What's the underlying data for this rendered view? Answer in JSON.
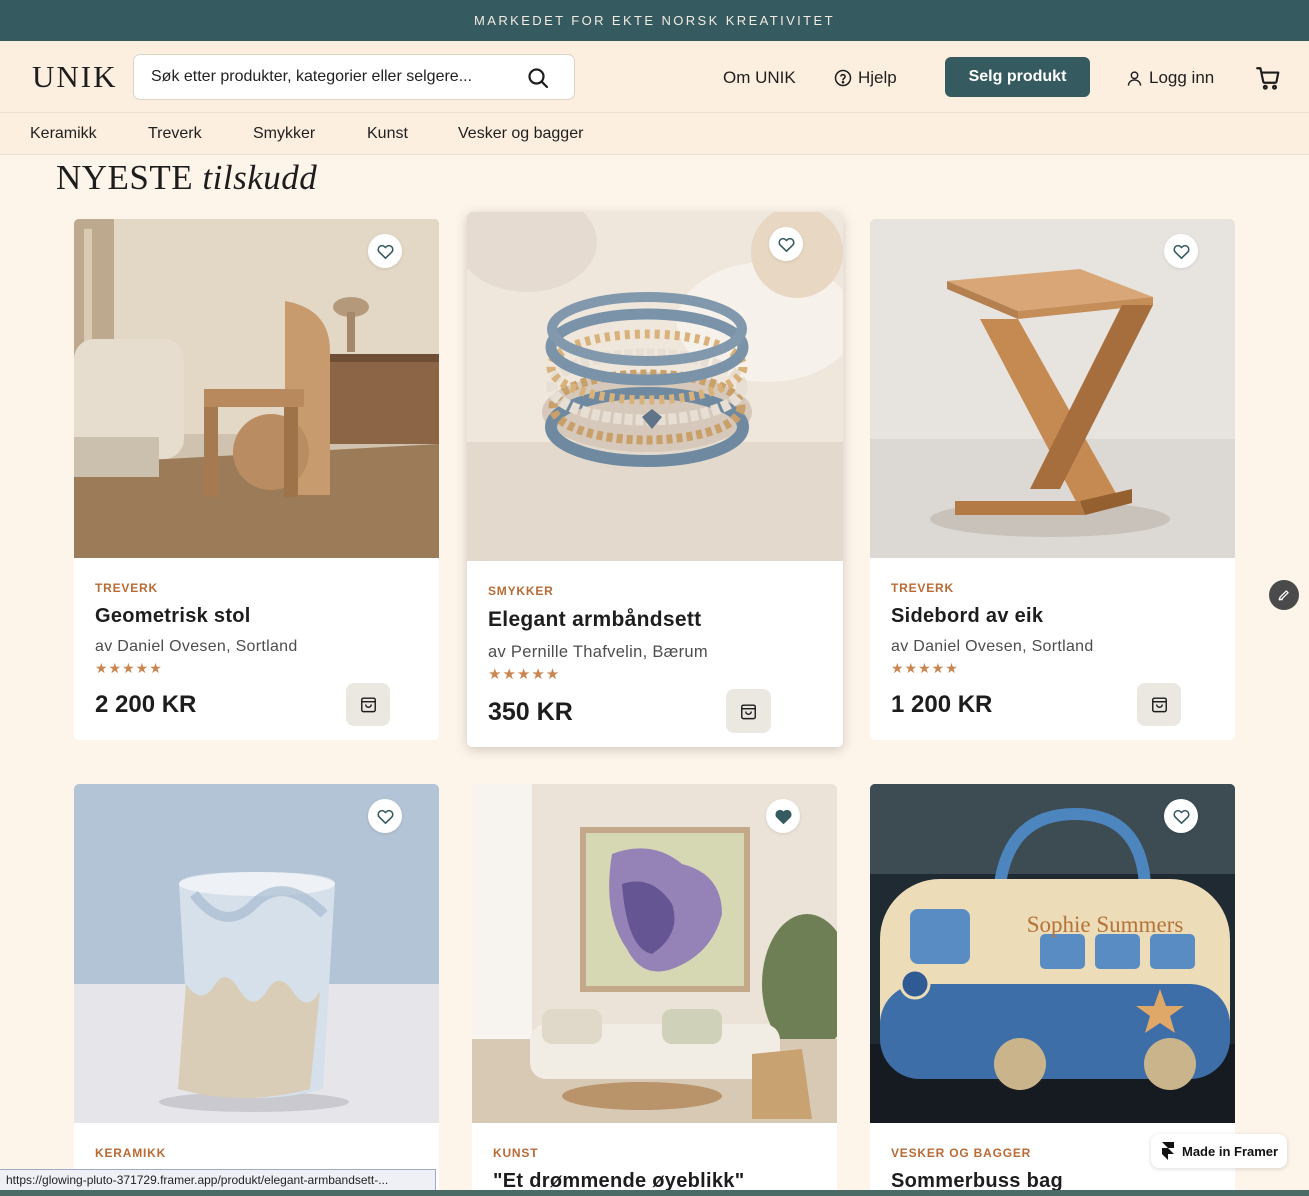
{
  "announcement": "MARKEDET FOR EKTE NORSK KREATIVITET",
  "header": {
    "logo": "UNIK",
    "search_placeholder": "Søk etter produkter, kategorier eller selgere...",
    "about": "Om UNIK",
    "help": "Hjelp",
    "sell_button": "Selg produkt",
    "login": "Logg inn"
  },
  "categories": [
    "Keramikk",
    "Treverk",
    "Smykker",
    "Kunst",
    "Vesker og bagger"
  ],
  "section": {
    "title_main": "NYESTE",
    "title_italic": "tilskudd"
  },
  "products": [
    {
      "category": "TREVERK",
      "title": "Geometrisk stol",
      "maker": "av Daniel Ovesen, Sortland",
      "stars": "★★★★★",
      "price": "2 200 KR",
      "favorited": false
    },
    {
      "category": "SMYKKER",
      "title": "Elegant armbåndsett",
      "maker": "av Pernille Thafvelin, Bærum",
      "stars": "★★★★★",
      "price": "350 KR",
      "favorited": false
    },
    {
      "category": "TREVERK",
      "title": "Sidebord av eik",
      "maker": "av Daniel Ovesen, Sortland",
      "stars": "★★★★★",
      "price": "1 200 KR",
      "favorited": false
    },
    {
      "category": "KERAMIKK",
      "title": "",
      "favorited": false
    },
    {
      "category": "KUNST",
      "title": "\"Et drømmende øyeblikk\"",
      "favorited": true
    },
    {
      "category": "VESKER OG BAGGER",
      "title": "Sommerbuss bag",
      "favorited": false
    }
  ],
  "bag_image_text": "Sophie Summers",
  "framer_badge": "Made in Framer",
  "status_url": "https://glowing-pluto-371729.framer.app/produkt/elegant-armbandsett-...",
  "colors": {
    "primary": "#355a5f",
    "background": "#fdf4ea",
    "accent": "#b86b35",
    "stars": "#c98650"
  },
  "icons": [
    "search-icon",
    "help-icon",
    "user-icon",
    "cart-icon",
    "heart-icon",
    "shopping-bag-icon",
    "edit-icon",
    "framer-logo-icon"
  ]
}
